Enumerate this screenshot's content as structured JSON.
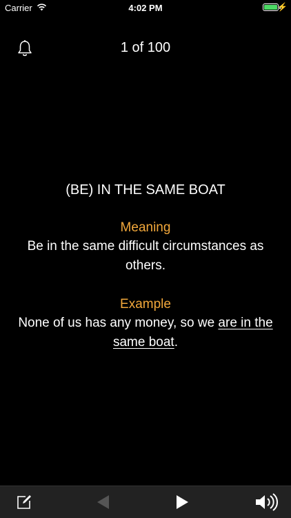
{
  "status": {
    "carrier": "Carrier",
    "time": "4:02 PM"
  },
  "header": {
    "counter": "1 of 100"
  },
  "card": {
    "idiom": "(BE) IN THE SAME BOAT",
    "meaning_label": "Meaning",
    "meaning_text": "Be in the same difficult circumstances as others.",
    "example_label": "Example",
    "example_before": "None of us has any money, so we ",
    "example_highlight": "are in the same boat",
    "example_after": "."
  },
  "toolbar": {
    "icons": [
      "edit-icon",
      "previous-icon",
      "play-icon",
      "speaker-icon"
    ],
    "previous_enabled": false
  }
}
